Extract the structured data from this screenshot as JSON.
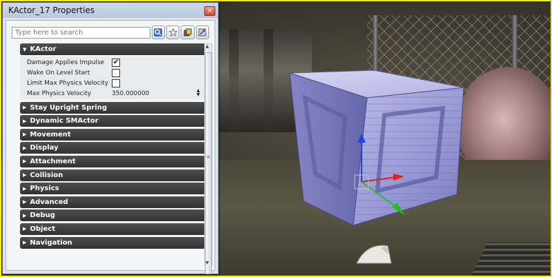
{
  "window": {
    "title": "KActor_17 Properties",
    "close_label": "×"
  },
  "search": {
    "placeholder": "Type here to search"
  },
  "toolbar": {
    "buttons": [
      "search-icon",
      "favorites-star-icon",
      "copy-icon",
      "settings-icon"
    ]
  },
  "expanded_category": {
    "label": "KActor",
    "properties": [
      {
        "label": "Damage Applies Impulse",
        "type": "checkbox",
        "checked": true,
        "mark": "✔"
      },
      {
        "label": "Wake On Level Start",
        "type": "checkbox",
        "checked": false,
        "mark": ""
      },
      {
        "label": "Limit Max Physics Velocity",
        "type": "checkbox",
        "checked": false,
        "mark": ""
      },
      {
        "label": "Max Physics Velocity",
        "type": "number",
        "value": "350.000000"
      }
    ]
  },
  "categories": [
    "Stay Upright Spring",
    "Dynamic SMActor",
    "Movement",
    "Display",
    "Attachment",
    "Collision",
    "Physics",
    "Advanced",
    "Debug",
    "Object",
    "Navigation"
  ],
  "colors": {
    "selection_border": "#f2ee10",
    "category_header": "#3a3a3a",
    "gizmo_x": "#e02020",
    "gizmo_y": "#20c020",
    "gizmo_z": "#2040e0",
    "crate_tint": "#8c8cd8"
  }
}
